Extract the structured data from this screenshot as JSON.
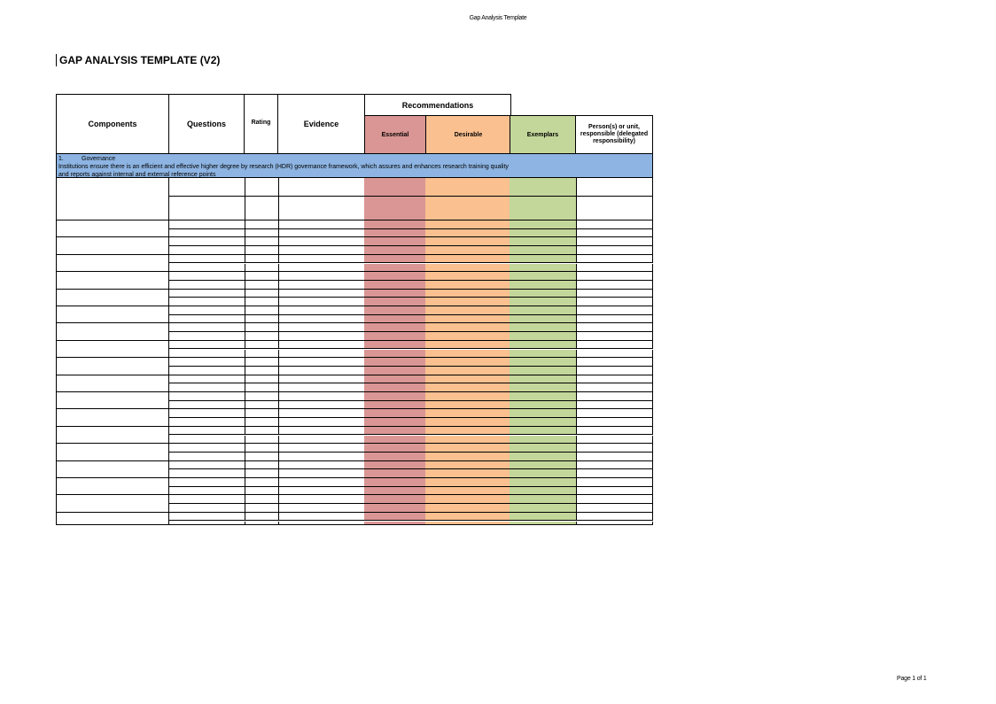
{
  "page_header": "Gap Analysis Template",
  "document_title": "GAP ANALYSIS TEMPLATE (V2)",
  "table": {
    "headers": {
      "components": "Components",
      "questions": "Questions",
      "rating": "Rating",
      "evidence": "Evidence",
      "recommendations": "Recommendations",
      "essential": "Essential",
      "desirable": "Desirable",
      "exemplars": "Exemplars",
      "person": "Person(s) or unit, responsible (delegated responsibility)"
    },
    "section": {
      "number": "1.",
      "title": "Governance",
      "description_line1": "Institutions ensure there is an efficient and effective higher degree by research (HDR) governance framework, which assures and enhances research training quality",
      "description_line2": "and reports against internal and external reference points"
    }
  },
  "colors": {
    "essential": "#da9694",
    "desirable": "#fac090",
    "exemplars": "#c4d79b",
    "section_band": "#8db4e2"
  },
  "footer": {
    "page_number": "Page 1 of 1"
  }
}
